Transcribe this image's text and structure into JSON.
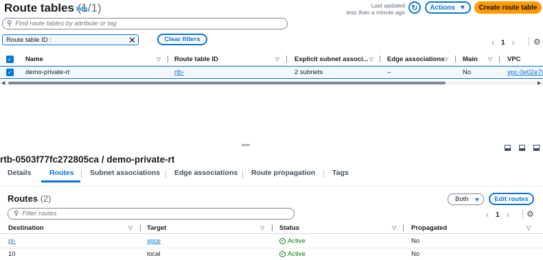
{
  "header": {
    "title": "Route tables",
    "count": "(1/1)",
    "info": "Info",
    "last_updated_label": "Last updated",
    "last_updated_value": "less than a minute ago",
    "actions_label": "Actions",
    "create_label": "Create route table"
  },
  "search": {
    "placeholder": "Find route tables by attribute or tag"
  },
  "filter": {
    "token_label": "Route table ID :",
    "clear_label": "Clear filters"
  },
  "pagination": {
    "page": "1"
  },
  "table": {
    "columns": [
      "Name",
      "Route table ID",
      "Explicit subnet associ...",
      "Edge associations",
      "Main",
      "VPC"
    ],
    "rows": [
      {
        "name": "demo-private-rt",
        "route_table_id": "rtb-",
        "explicit_subnet": "2 subnets",
        "edge_associations": "–",
        "main": "No",
        "vpc": "vpc-0e02e70"
      }
    ]
  },
  "detail": {
    "title": "rtb-0503f77fc272805ca / demo-private-rt",
    "tabs": [
      "Details",
      "Routes",
      "Subnet associations",
      "Edge associations",
      "Route propagation",
      "Tags"
    ],
    "active_tab": "Routes"
  },
  "routes": {
    "title": "Routes",
    "count": "(2)",
    "select_value": "Both",
    "edit_label": "Edit routes",
    "search_placeholder": "Filter routes",
    "page": "1",
    "columns": [
      "Destination",
      "Target",
      "Status",
      "Propagated"
    ],
    "rows": [
      {
        "destination": "pl-",
        "target": "vpce",
        "status": "Active",
        "propagated": "No"
      },
      {
        "destination": "10",
        "target": "local",
        "status": "Active",
        "propagated": "No"
      }
    ]
  },
  "colors": {
    "accent": "#0972d3",
    "primary_button": "#ff9900",
    "success": "#037f0c"
  }
}
